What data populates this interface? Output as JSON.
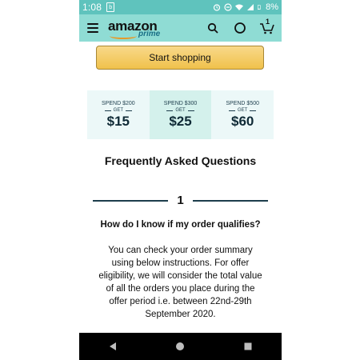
{
  "status_bar": {
    "time": "1:08",
    "battery_percent": "8%"
  },
  "header": {
    "logo_word": "amazon",
    "logo_sub": "prime",
    "cart_count": "1"
  },
  "cta": {
    "label": "Start shopping"
  },
  "offers": [
    {
      "spend": "SPEND $200",
      "get": "GET",
      "amount": "$15"
    },
    {
      "spend": "SPEND $300",
      "get": "GET",
      "amount": "$25"
    },
    {
      "spend": "SPEND $500",
      "get": "GET",
      "amount": "$60"
    }
  ],
  "faq": {
    "title": "Frequently Asked Questions",
    "number": "1",
    "question": "How do I know if my order qualifies?",
    "answer": "You can check your order summary using below instructions. For offer eligibility, we will consider the total value of all the orders you place during the offer period i.e. between 22nd-29th September 2020."
  },
  "colors": {
    "status_bar": "#5fc3bd",
    "app_bar": "#8fdcd4",
    "button": "#f0c14b",
    "tile": "#ecf8f8",
    "tile_highlight": "#d4f1ec"
  }
}
